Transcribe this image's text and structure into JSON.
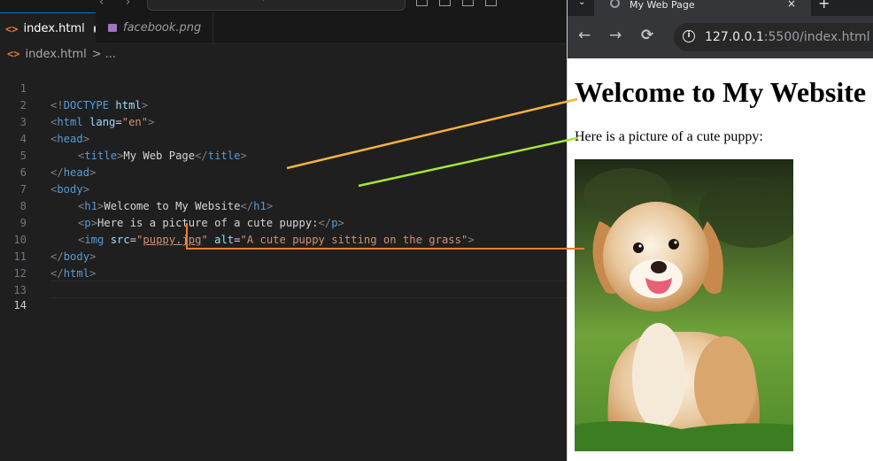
{
  "editor": {
    "tabs": [
      {
        "label": "index.html",
        "active": true,
        "dirty": true
      },
      {
        "label": "facebook.png",
        "active": false
      }
    ],
    "breadcrumb": {
      "file": "index.html",
      "sep": ">",
      "more": "..."
    },
    "line_numbers": [
      "1",
      "2",
      "3",
      "4",
      "5",
      "6",
      "7",
      "8",
      "9",
      "10",
      "11",
      "12",
      "13",
      "14"
    ],
    "code": {
      "l1": {
        "a": "<!",
        "b": "DOCTYPE",
        "c": " html",
        "d": ">"
      },
      "l2": {
        "a": "<",
        "b": "html",
        "c": " lang",
        "d": "=",
        "e": "\"en\"",
        "f": ">"
      },
      "l3": {
        "a": "<",
        "b": "head",
        "c": ">"
      },
      "l4": {
        "a": "<",
        "b": "title",
        "c": ">",
        "d": "My Web Page",
        "e": "</",
        "f": "title",
        "g": ">"
      },
      "l5": {
        "a": "</",
        "b": "head",
        "c": ">"
      },
      "l6": {
        "a": "<",
        "b": "body",
        "c": ">"
      },
      "l7": {
        "a": "<",
        "b": "h1",
        "c": ">",
        "d": "Welcome to My Website",
        "e": "</",
        "f": "h1",
        "g": ">"
      },
      "l8": {
        "a": "<",
        "b": "p",
        "c": ">",
        "d": "Here is a picture of a cute puppy:",
        "e": "</",
        "f": "p",
        "g": ">"
      },
      "l9": {
        "a": "<",
        "b": "img",
        "c": " src",
        "d": "=",
        "e": "\"",
        "f": "puppy.jpg",
        "g": "\"",
        "h": " alt",
        "i": "=",
        "j": "\"A cute puppy sitting on the grass\"",
        "k": ">"
      },
      "l10": {
        "a": "</",
        "b": "body",
        "c": ">"
      },
      "l11": {
        "a": "</",
        "b": "html",
        "c": ">"
      }
    }
  },
  "browser": {
    "tab_title": "My Web Page",
    "tab_close": "×",
    "new_tab": "+",
    "tab_menu": "⌄",
    "back_icon": "←",
    "forward_icon": "→",
    "reload_icon": "⟳",
    "info_icon": "i",
    "url_host": "127.0.0.1",
    "url_rest": ":5500/index.html"
  },
  "page": {
    "heading": "Welcome to My Website",
    "paragraph": "Here is a picture of a cute puppy:"
  },
  "colors": {
    "annotation_heading": "#f5b23c",
    "annotation_paragraph": "#a8e632",
    "annotation_image": "#ef7d2f",
    "tag": "#569cd6",
    "attr": "#9cdcfe",
    "string": "#ce9178"
  }
}
